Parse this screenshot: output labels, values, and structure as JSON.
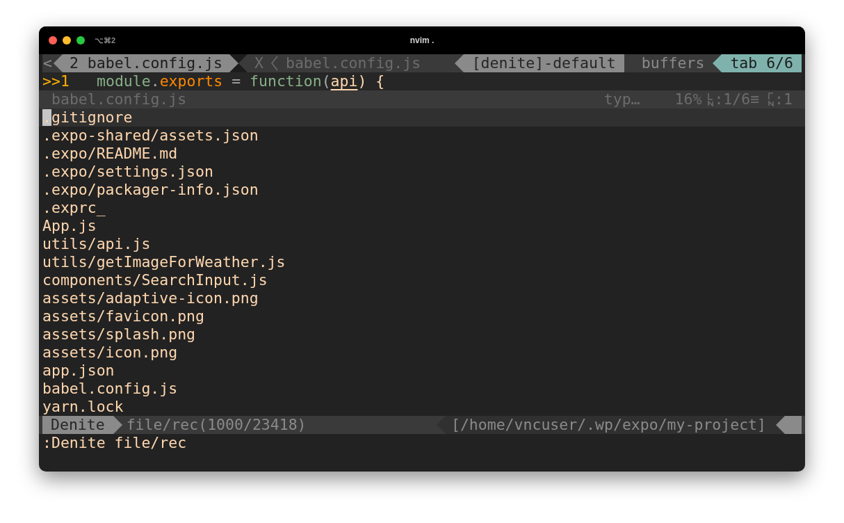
{
  "window": {
    "shortcut": "⌥⌘2",
    "title": "nvim ."
  },
  "tabline": {
    "left_marker": "<",
    "current_tab": "2 babel.config.js",
    "close": "X",
    "other_tab": "babel.config.js",
    "right": [
      {
        "label": "[denite]-default",
        "kind": "light"
      },
      {
        "label": "buffers",
        "kind": "dark"
      },
      {
        "label": "tab 6/6",
        "kind": "accent"
      }
    ]
  },
  "editor_line": {
    "sign": ">>1",
    "tokens": [
      {
        "text": "module",
        "kind": "green"
      },
      {
        "text": ".",
        "kind": "plain"
      },
      {
        "text": "exports",
        "kind": "orange"
      },
      {
        "text": " = ",
        "kind": "plain"
      },
      {
        "text": "function",
        "kind": "green"
      },
      {
        "text": "(",
        "kind": "plain"
      },
      {
        "text": "api",
        "kind": "param"
      },
      {
        "text": ") {",
        "kind": "peach"
      }
    ]
  },
  "denite_header": {
    "file": "babel.config.js",
    "filetype": "typ…",
    "percent": "16%",
    "line": ":1/6≡",
    "column": ":1"
  },
  "candidates": [
    {
      "text": ".gitignore",
      "selected": true
    },
    {
      "text": ".expo-shared/assets.json",
      "selected": false
    },
    {
      "text": ".expo/README.md",
      "selected": false
    },
    {
      "text": ".expo/settings.json",
      "selected": false
    },
    {
      "text": ".expo/packager-info.json",
      "selected": false
    },
    {
      "text": ".exprc_",
      "selected": false
    },
    {
      "text": "App.js",
      "selected": false
    },
    {
      "text": "utils/api.js",
      "selected": false
    },
    {
      "text": "utils/getImageForWeather.js",
      "selected": false
    },
    {
      "text": "components/SearchInput.js",
      "selected": false
    },
    {
      "text": "assets/adaptive-icon.png",
      "selected": false
    },
    {
      "text": "assets/favicon.png",
      "selected": false
    },
    {
      "text": "assets/splash.png",
      "selected": false
    },
    {
      "text": "assets/icon.png",
      "selected": false
    },
    {
      "text": "app.json",
      "selected": false
    },
    {
      "text": "babel.config.js",
      "selected": false
    },
    {
      "text": "yarn.lock",
      "selected": false
    }
  ],
  "statusline": {
    "mode": "Denite",
    "source": "file/rec(1000/23418)",
    "path": "[/home/vncuser/.wp/expo/my-project]"
  },
  "cmdline": ":Denite file/rec"
}
